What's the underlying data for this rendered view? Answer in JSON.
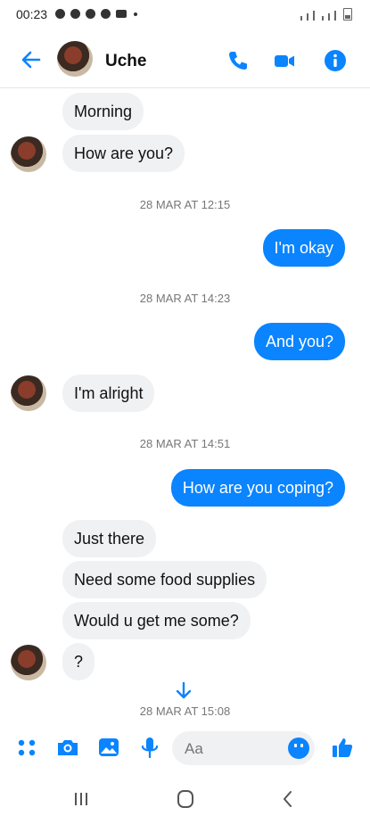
{
  "status_bar": {
    "time": "00:23"
  },
  "header": {
    "contact_name": "Uche"
  },
  "messages": [
    {
      "text": "Morning"
    },
    {
      "text": "How are you?"
    },
    {
      "timestamp": "28 MAR AT 12:15"
    },
    {
      "text": "I'm okay"
    },
    {
      "timestamp": "28 MAR AT 14:23"
    },
    {
      "text": "And you?"
    },
    {
      "text": "I'm alright"
    },
    {
      "timestamp": "28 MAR AT 14:51"
    },
    {
      "text": "How are you coping?"
    },
    {
      "text": "Just there"
    },
    {
      "text": "Need some food supplies"
    },
    {
      "text": "Would u get me some?"
    },
    {
      "text": "?"
    },
    {
      "timestamp": "28 MAR AT 15:08"
    }
  ],
  "composer": {
    "placeholder": "Aa"
  },
  "colors": {
    "accent": "#0a84ff",
    "incoming_bubble": "#f0f1f3"
  },
  "icons": [
    "back-arrow-icon",
    "phone-icon",
    "video-camera-icon",
    "info-icon",
    "apps-icon",
    "camera-icon",
    "gallery-icon",
    "microphone-icon",
    "emoji-icon",
    "thumbs-up-icon",
    "recent-apps-icon",
    "home-icon",
    "nav-back-icon",
    "scroll-down-icon"
  ]
}
